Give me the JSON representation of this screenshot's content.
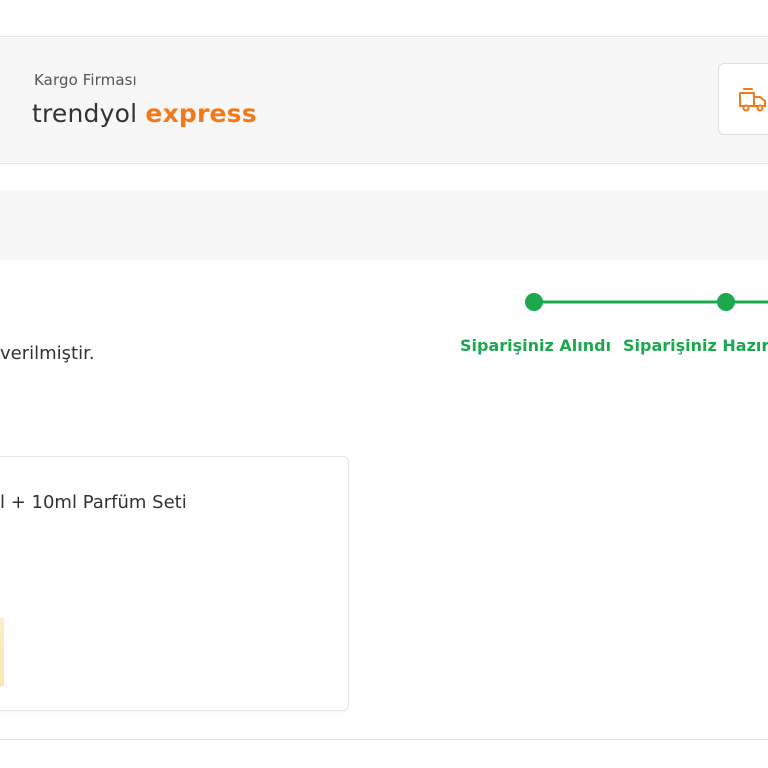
{
  "cargo": {
    "label": "Kargo Firması",
    "brand_primary": "trendyol",
    "brand_secondary": "express",
    "track_icon": "package-truck-icon"
  },
  "order": {
    "status_text": "verilmiştir."
  },
  "timeline": {
    "steps": [
      {
        "label": "Siparişiniz Alındı",
        "state": "done"
      },
      {
        "label": "Siparişiniz Hazırl",
        "state": "done"
      }
    ],
    "color": "#1ba84f"
  },
  "product": {
    "name": "l + 10ml Parfüm Seti"
  },
  "colors": {
    "brand_orange": "#f27a1a",
    "success_green": "#1ba84f",
    "panel_gray": "#f7f7f7"
  }
}
